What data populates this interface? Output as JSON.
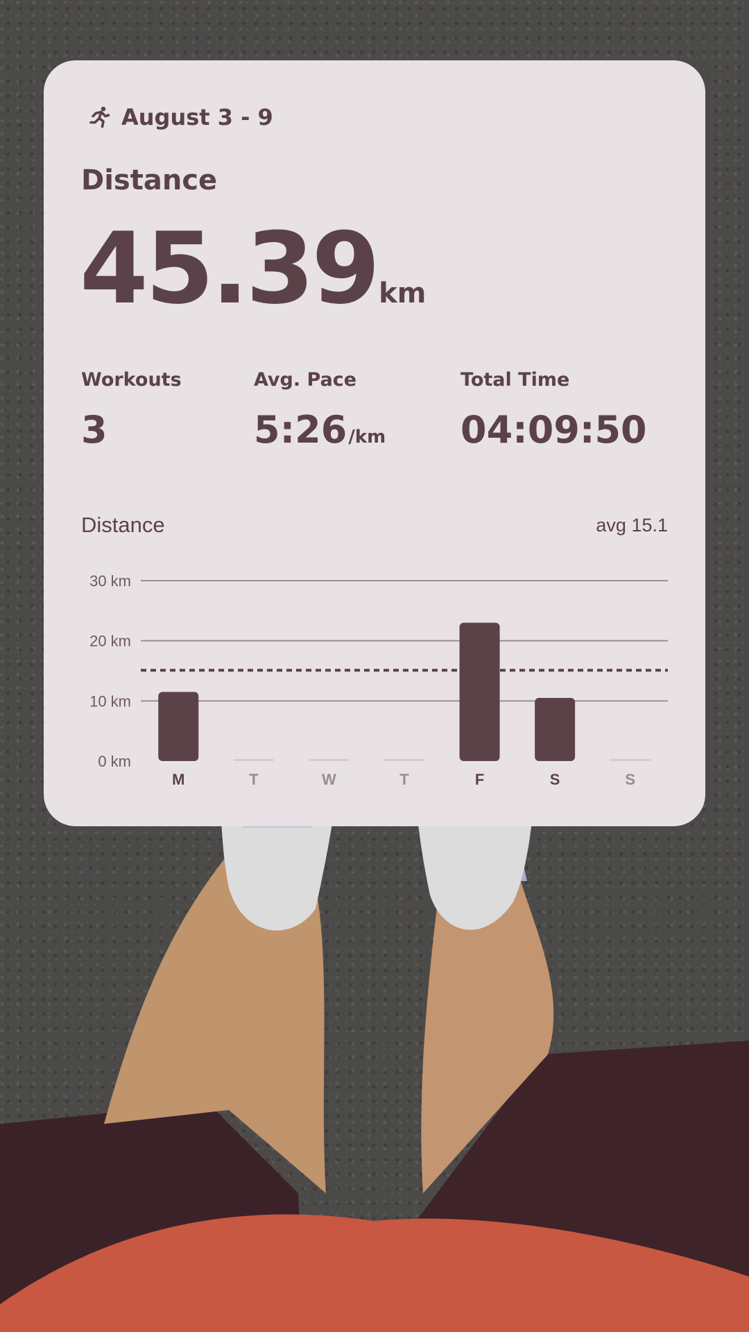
{
  "card": {
    "period": "August 3 - 9",
    "icon": "running-person-icon",
    "metric_title": "Distance",
    "total_value": "45.39",
    "total_unit": "km",
    "stats": [
      {
        "label": "Workouts",
        "value": "3",
        "unit": ""
      },
      {
        "label": "Avg. Pace",
        "value": "5:26",
        "unit": "/km"
      },
      {
        "label": "Total Time",
        "value": "04:09:50",
        "unit": ""
      }
    ]
  },
  "colors": {
    "card_bg": "#e8e2e5",
    "accent": "#5b4249",
    "gridline": "#a08c92",
    "muted_bar": "#d5cdd1"
  },
  "chart_data": {
    "type": "bar",
    "title": "Distance",
    "avg_label": "avg 15.1",
    "average": 15.1,
    "categories": [
      "M",
      "T",
      "W",
      "T",
      "F",
      "S",
      "S"
    ],
    "values": [
      11.5,
      0,
      0,
      0,
      23,
      10.5,
      0
    ],
    "yticks": [
      "0 km",
      "10 km",
      "20 km",
      "30 km"
    ],
    "ylim": [
      0,
      30
    ],
    "grid": true
  }
}
